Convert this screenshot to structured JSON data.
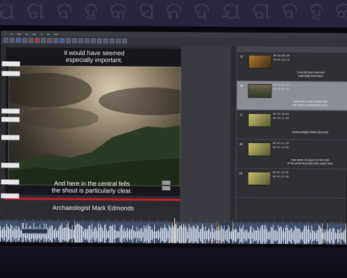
{
  "video": {
    "subtitle_top_1": "it would have seemed",
    "subtitle_top_2": "especially important.",
    "subtitle_bottom_1": "And here in the central fells",
    "subtitle_bottom_2": "the shout is particularly clear.",
    "caption": "Archaeologist Mark Edmonds"
  },
  "subtitle_list": {
    "rows": [
      {
        "num": "15",
        "tc_in": "00:03:00:05",
        "tc_out": "00:03:02:15",
        "text_1": "it would have seemed",
        "text_2": "especially important."
      },
      {
        "num": "16",
        "tc_in": "00:03:03:05",
        "tc_out": "00:03:05:02",
        "text_1": "And here in the central fells",
        "text_2": "the shout is particularly clear."
      },
      {
        "num": "17",
        "tc_in": "00:03:09:00",
        "tc_out": "00:03:11:00",
        "text_1": "Archaeologist Mark Edmonds",
        "text_2": ""
      },
      {
        "num": "18",
        "tc_in": "00:03:11:10",
        "tc_out": "00:03:14:06",
        "text_1": "has spent 30 years on the trail",
        "text_2": "of the ancient people who came here"
      },
      {
        "num": "19",
        "tc_in": "00:03:15:05",
        "tc_out": "00:03:17:20",
        "text_1": "",
        "text_2": ""
      }
    ]
  },
  "colors": {
    "accent": "#c21f2a",
    "selected_row": "#8b8d97",
    "waveform": "#dfe6f3"
  }
}
